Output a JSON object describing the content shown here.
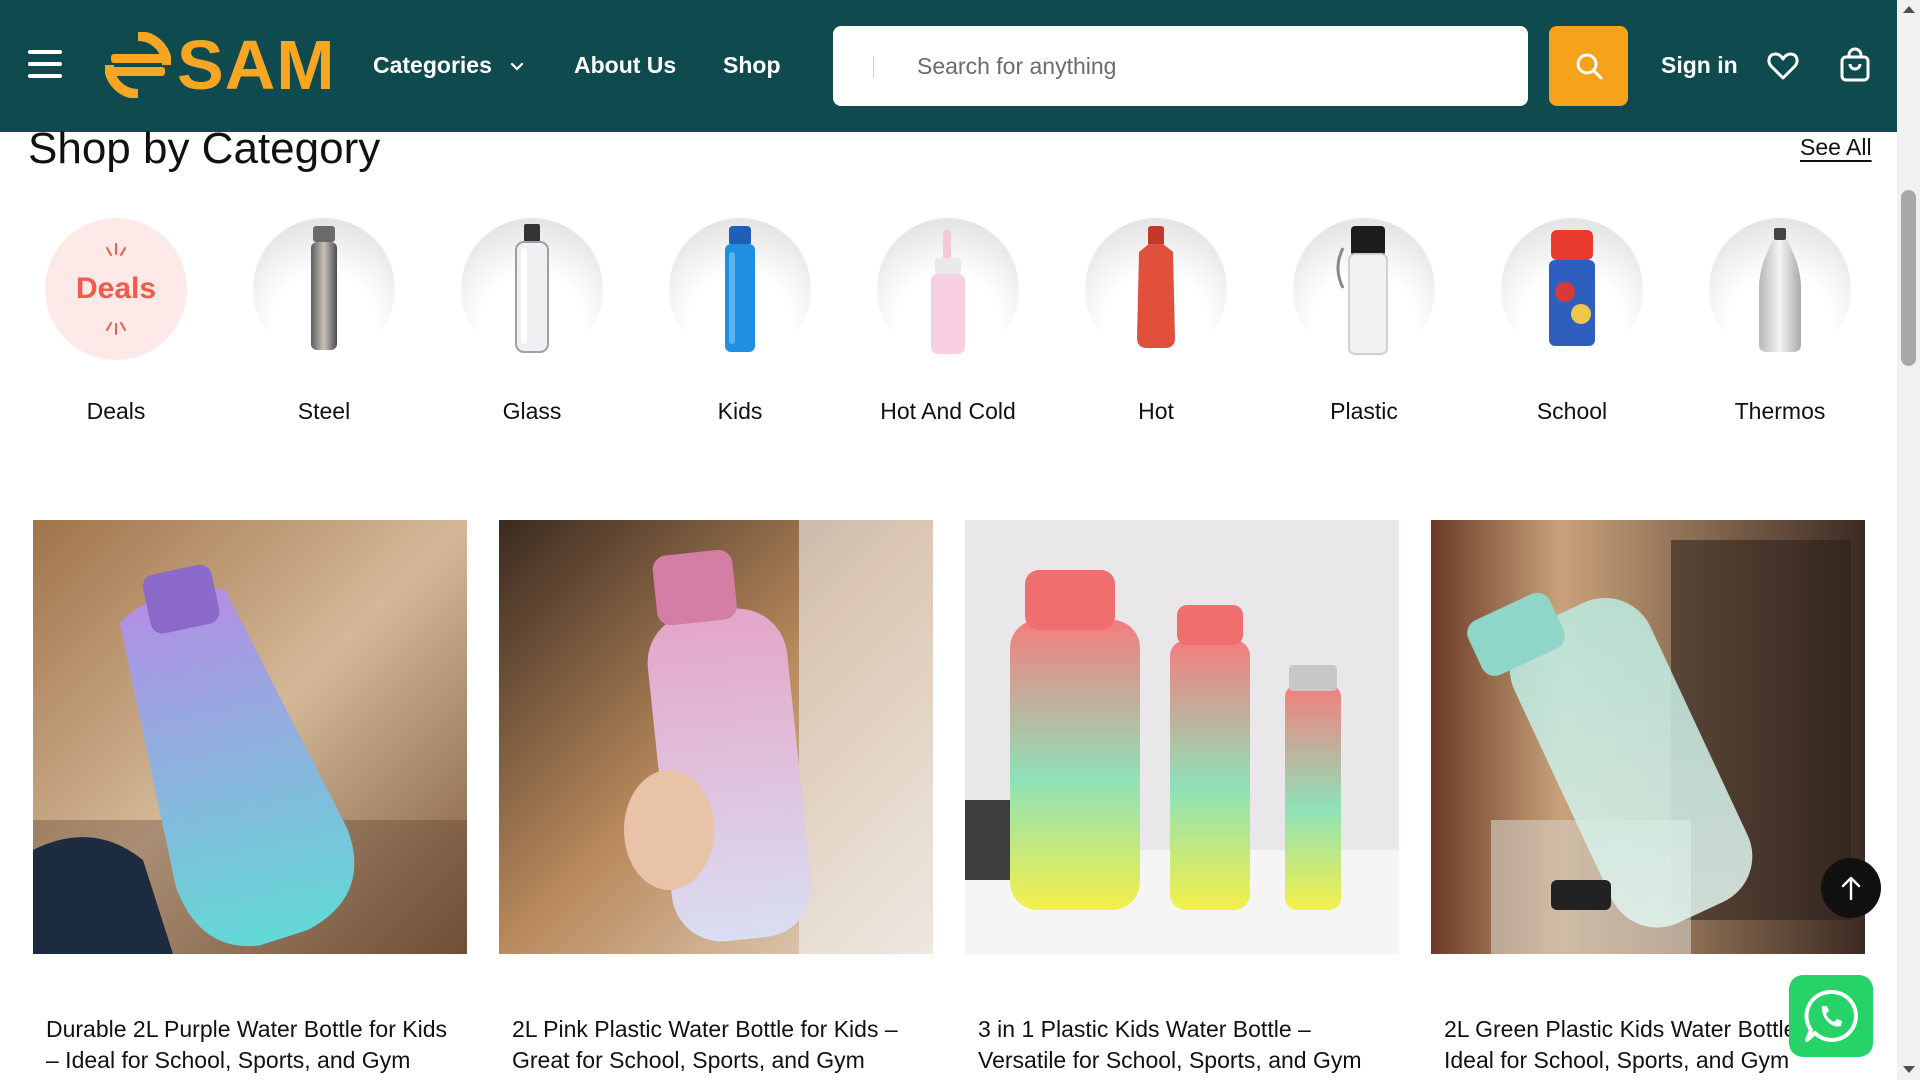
{
  "header": {
    "logo_text": "SAM",
    "nav": {
      "categories": "Categories",
      "about": "About Us",
      "shop": "Shop"
    },
    "search_placeholder": "Search for anything",
    "sign_in": "Sign in"
  },
  "section": {
    "title": "Shop by Category",
    "see_all": "See All"
  },
  "categories": [
    {
      "label": "Deals",
      "badge": "Deals"
    },
    {
      "label": "Steel"
    },
    {
      "label": "Glass"
    },
    {
      "label": "Kids"
    },
    {
      "label": "Hot And Cold"
    },
    {
      "label": "Hot"
    },
    {
      "label": "Plastic"
    },
    {
      "label": "School"
    },
    {
      "label": "Thermos"
    }
  ],
  "products": [
    {
      "title": "Durable 2L Purple Water Bottle for Kids – Ideal for School, Sports, and Gym"
    },
    {
      "title": "2L Pink Plastic Water Bottle for Kids – Great for School, Sports, and Gym"
    },
    {
      "title": "3 in 1 Plastic Kids Water Bottle – Versatile for School, Sports, and Gym"
    },
    {
      "title": "2L Green Plastic Kids Water Bottle – Ideal for School, Sports, and Gym"
    }
  ],
  "colors": {
    "header_bg": "#0f4a4f",
    "accent": "#f7a21b",
    "deals_red": "#f25a4a",
    "whatsapp": "#25d366"
  },
  "icons": {
    "menu": "hamburger-icon",
    "search": "search-icon",
    "wishlist": "heart-icon",
    "cart": "shopping-bag-icon",
    "back_to_top": "arrow-up-icon",
    "chat": "whatsapp-icon"
  }
}
